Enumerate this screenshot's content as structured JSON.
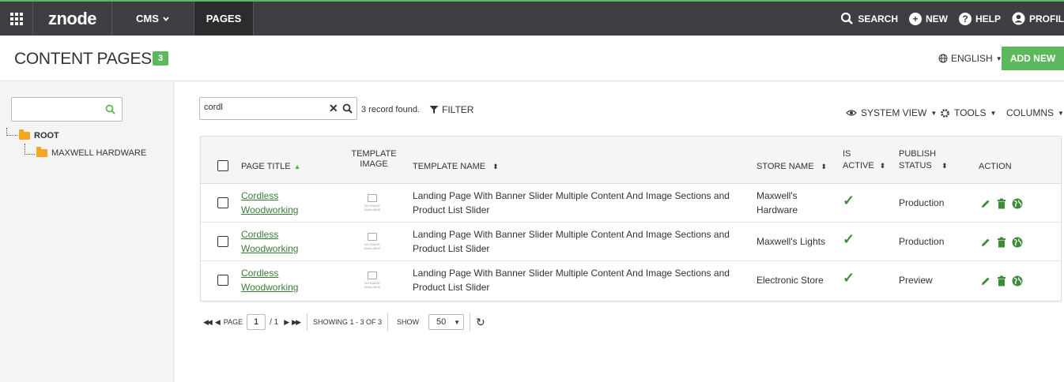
{
  "topbar": {
    "logo": "znode",
    "nav": [
      {
        "label": "CMS"
      },
      {
        "label": "PAGES"
      }
    ],
    "right": {
      "search": "SEARCH",
      "new": "NEW",
      "help": "HELP",
      "profile": "PROFIL"
    },
    "accent_color": "#5cb85c"
  },
  "header": {
    "title": "CONTENT PAGES",
    "count": "3",
    "language": "ENGLISH",
    "add_new": "ADD NEW"
  },
  "sidebar": {
    "tree": [
      {
        "label": "ROOT"
      },
      {
        "label": "MAXWELL HARDWARE"
      }
    ]
  },
  "toolbar": {
    "search_value": "cordl",
    "records_found": "3 record found.",
    "filter": "FILTER",
    "system_view": "SYSTEM VIEW",
    "tools": "TOOLS",
    "columns": "COLUMNS"
  },
  "table": {
    "columns": {
      "page_title": "PAGE TITLE",
      "template_image_1": "TEMPLATE",
      "template_image_2": "IMAGE",
      "template_name": "TEMPLATE NAME",
      "store_name": "STORE NAME",
      "is_active_1": "IS",
      "is_active_2": "ACTIVE",
      "publish_status_1": "PUBLISH",
      "publish_status_2": "STATUS",
      "action": "ACTION"
    },
    "no_image_label": "NO IMAGE AVAILABLE",
    "rows": [
      {
        "title_1": "Cordless",
        "title_2": "Woodworking",
        "template_1": "Landing Page With Banner Slider Multiple Content And Image Sections and",
        "template_2": "Product List Slider",
        "store_1": "Maxwell's",
        "store_2": "Hardware",
        "status": "Production",
        "active": true
      },
      {
        "title_1": "Cordless",
        "title_2": "Woodworking",
        "template_1": "Landing Page With Banner Slider Multiple Content And Image Sections and",
        "template_2": "Product List Slider",
        "store_1": "Maxwell's Lights",
        "store_2": "",
        "status": "Production",
        "active": true
      },
      {
        "title_1": "Cordless",
        "title_2": "Woodworking",
        "template_1": "Landing Page With Banner Slider Multiple Content And Image Sections and",
        "template_2": "Product List Slider",
        "store_1": "Electronic Store",
        "store_2": "",
        "status": "Preview",
        "active": true
      }
    ]
  },
  "pager": {
    "page_label": "PAGE",
    "page_value": "1",
    "of_total": "/ 1",
    "showing": "SHOWING 1 - 3 OF 3",
    "show_label": "SHOW",
    "page_size": "50"
  }
}
